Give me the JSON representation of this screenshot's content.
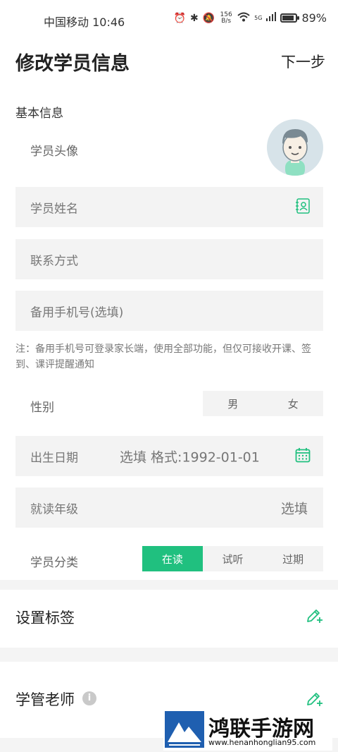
{
  "status_bar": {
    "carrier_time": "中国移动 10:46",
    "net_speed": "156 B/s",
    "network": "5G",
    "battery_percent": "89%",
    "battery_level": 0.89
  },
  "header": {
    "title": "修改学员信息",
    "next_label": "下一步"
  },
  "basic": {
    "section_label": "基本信息",
    "avatar_label": "学员头像",
    "name_placeholder": "学员姓名",
    "contact_placeholder": "联系方式",
    "backup_phone_placeholder": "备用手机号(选填)",
    "note": "注：备用手机号可登录家长端，使用全部功能，但仅可接收开课、签到、课评提醒通知",
    "gender_label": "性别",
    "gender_options": [
      "男",
      "女"
    ],
    "birthday_label": "出生日期",
    "birthday_placeholder": "选填 格式:1992-01-01",
    "grade_label": "就读年级",
    "grade_placeholder": "选填",
    "category_label": "学员分类",
    "category_options": [
      "在读",
      "试听",
      "过期"
    ],
    "category_selected": "在读"
  },
  "tags": {
    "title": "设置标签"
  },
  "teacher": {
    "title": "学管老师",
    "info_icon": "info-icon"
  },
  "watermark": {
    "brand": "鸿联手游网",
    "url": "www.henanhonglian95.com"
  },
  "colors": {
    "accent": "#20c07f"
  }
}
